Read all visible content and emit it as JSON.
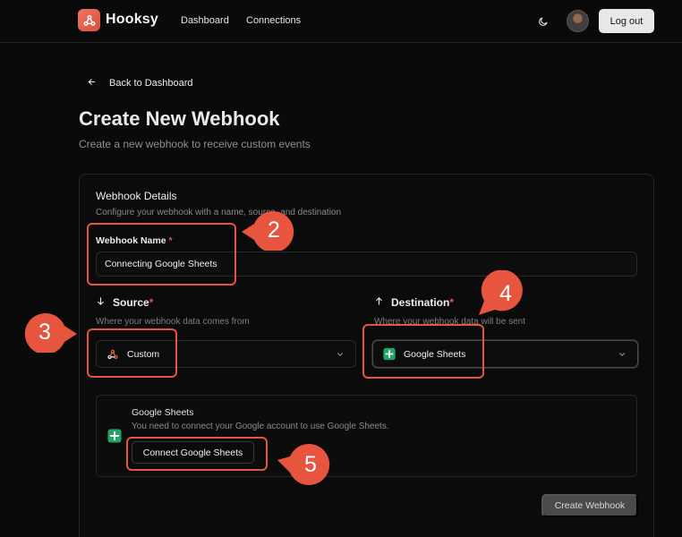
{
  "header": {
    "brand": "Hooksy",
    "nav": [
      "Dashboard",
      "Connections"
    ],
    "logout_label": "Log out"
  },
  "page": {
    "back_label": "Back to Dashboard",
    "title": "Create New Webhook",
    "subtitle": "Create a new webhook to receive custom events"
  },
  "form": {
    "card_title": "Webhook Details",
    "card_desc": "Configure your webhook with a name, source, and destination",
    "name_label": "Webhook Name",
    "required_mark": "*",
    "name_value": "Connecting Google Sheets",
    "source": {
      "label": "Source",
      "desc": "Where your webhook data comes from",
      "selected": "Custom"
    },
    "destination": {
      "label": "Destination",
      "desc": "Where your webhook data will be sent",
      "selected": "Google Sheets"
    },
    "sheets_box": {
      "title": "Google Sheets",
      "desc": "You need to connect your Google account to use Google Sheets.",
      "connect_label": "Connect Google Sheets"
    },
    "submit_label": "Create Webhook"
  },
  "annotations": {
    "callouts": [
      "2",
      "3",
      "4",
      "5"
    ]
  },
  "colors": {
    "background": "#0a0a0a",
    "brand_accent": "#e7553f",
    "required": "#e0594b",
    "sheets_green": "#21a464"
  },
  "icons": [
    "webhook-logo-icon",
    "moon-icon",
    "arrow-left-icon",
    "arrow-down-icon",
    "arrow-up-icon",
    "chevron-down-icon",
    "google-sheets-icon"
  ]
}
